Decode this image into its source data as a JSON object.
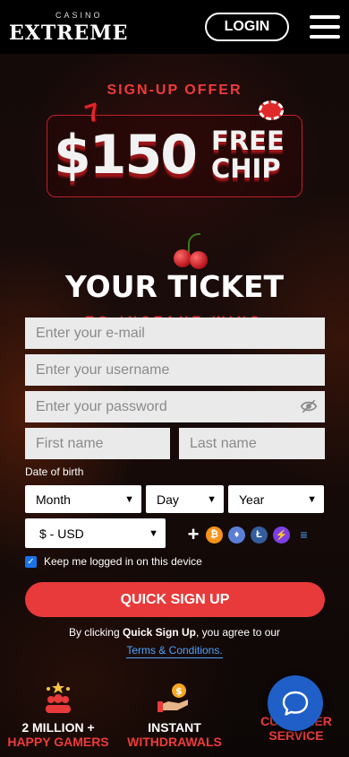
{
  "header": {
    "logo_small": "CASINO",
    "logo_big": "EXTREME",
    "login_label": "LOGIN"
  },
  "promo": {
    "signup_offer": "SIGN-UP OFFER",
    "amount": "$150",
    "free": "FREE",
    "chip": "CHIP",
    "ticket": "YOUR TICKET",
    "instant": "TO INSTANT WINS"
  },
  "form": {
    "email_placeholder": "Enter your e-mail",
    "username_placeholder": "Enter your username",
    "password_placeholder": "Enter your password",
    "first_name_placeholder": "First name",
    "last_name_placeholder": "Last name",
    "dob_label": "Date of birth",
    "month": "Month",
    "day": "Day",
    "year": "Year",
    "currency": "$ - USD",
    "keep_logged": "Keep me logged in on this device",
    "signup_button": "QUICK SIGN UP",
    "terms_prefix": "By clicking ",
    "terms_bold": "Quick Sign Up",
    "terms_suffix": ", you agree to our",
    "terms_link": "Terms & Conditions."
  },
  "features": [
    {
      "line1": "2 MILLION +",
      "line2": "HAPPY GAMERS"
    },
    {
      "line1": "INSTANT",
      "line2": "WITHDRAWALS"
    },
    {
      "line1": "",
      "line2": "CUSTOMER SERVICE"
    }
  ],
  "colors": {
    "accent_red": "#e83a3a",
    "link_blue": "#4aa3ff",
    "chat_blue": "#1f5fc7"
  },
  "icons": {
    "crypto": [
      "bitcoin-icon",
      "ethereum-icon",
      "litecoin-icon",
      "lightning-icon",
      "solana-icon"
    ]
  }
}
